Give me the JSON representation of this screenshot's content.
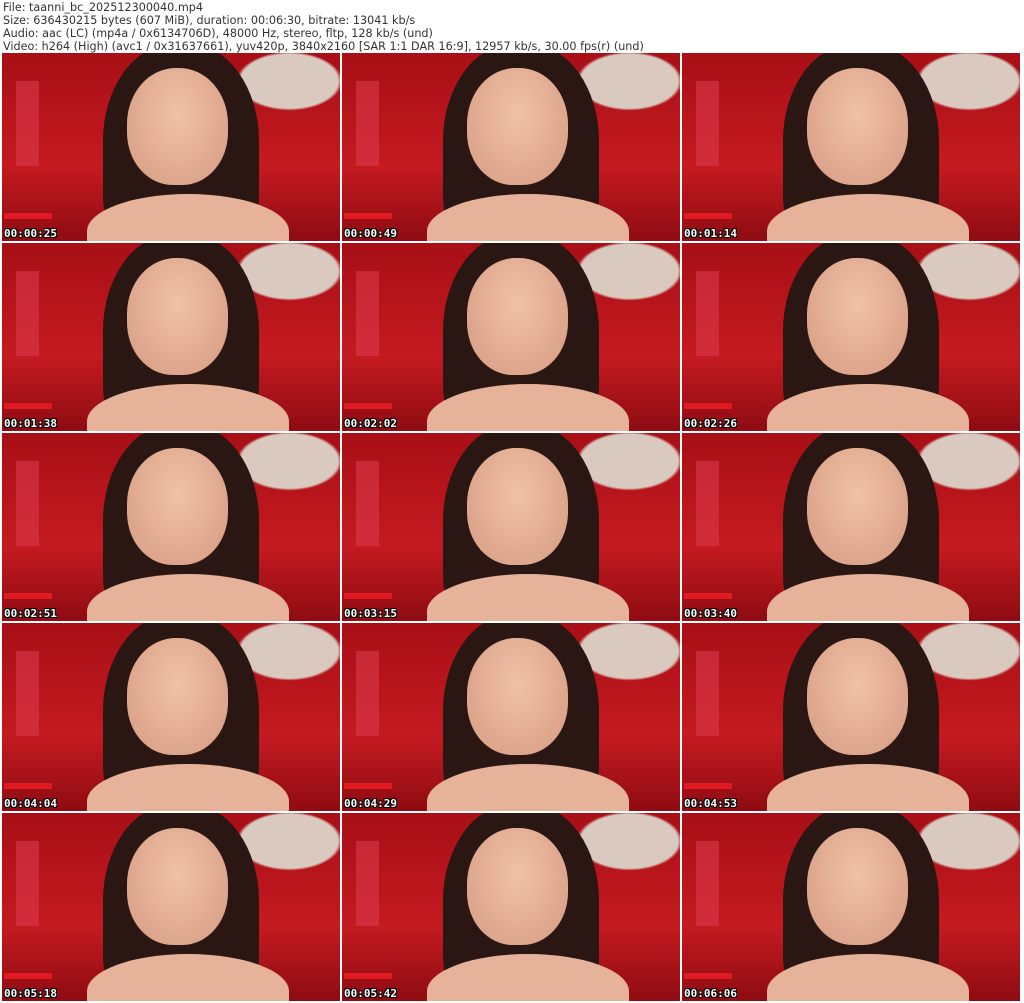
{
  "header": {
    "file": "File: taanni_bc_202512300040.mp4",
    "size": "Size: 636430215 bytes (607 MiB), duration: 00:06:30, bitrate: 13041 kb/s",
    "audio": "Audio: aac (LC) (mp4a / 0x6134706D), 48000 Hz, stereo, fltp, 128 kb/s (und)",
    "video": "Video: h264 (High) (avc1 / 0x31637661), yuv420p, 3840x2160 [SAR 1:1 DAR 16:9], 12957 kb/s, 30.00 fps(r) (und)"
  },
  "thumbnails": [
    {
      "time": "00:00:25"
    },
    {
      "time": "00:00:49"
    },
    {
      "time": "00:01:14"
    },
    {
      "time": "00:01:38"
    },
    {
      "time": "00:02:02"
    },
    {
      "time": "00:02:26"
    },
    {
      "time": "00:02:51"
    },
    {
      "time": "00:03:15"
    },
    {
      "time": "00:03:40"
    },
    {
      "time": "00:04:04"
    },
    {
      "time": "00:04:29"
    },
    {
      "time": "00:04:53"
    },
    {
      "time": "00:05:18"
    },
    {
      "time": "00:05:42"
    },
    {
      "time": "00:06:06"
    }
  ]
}
